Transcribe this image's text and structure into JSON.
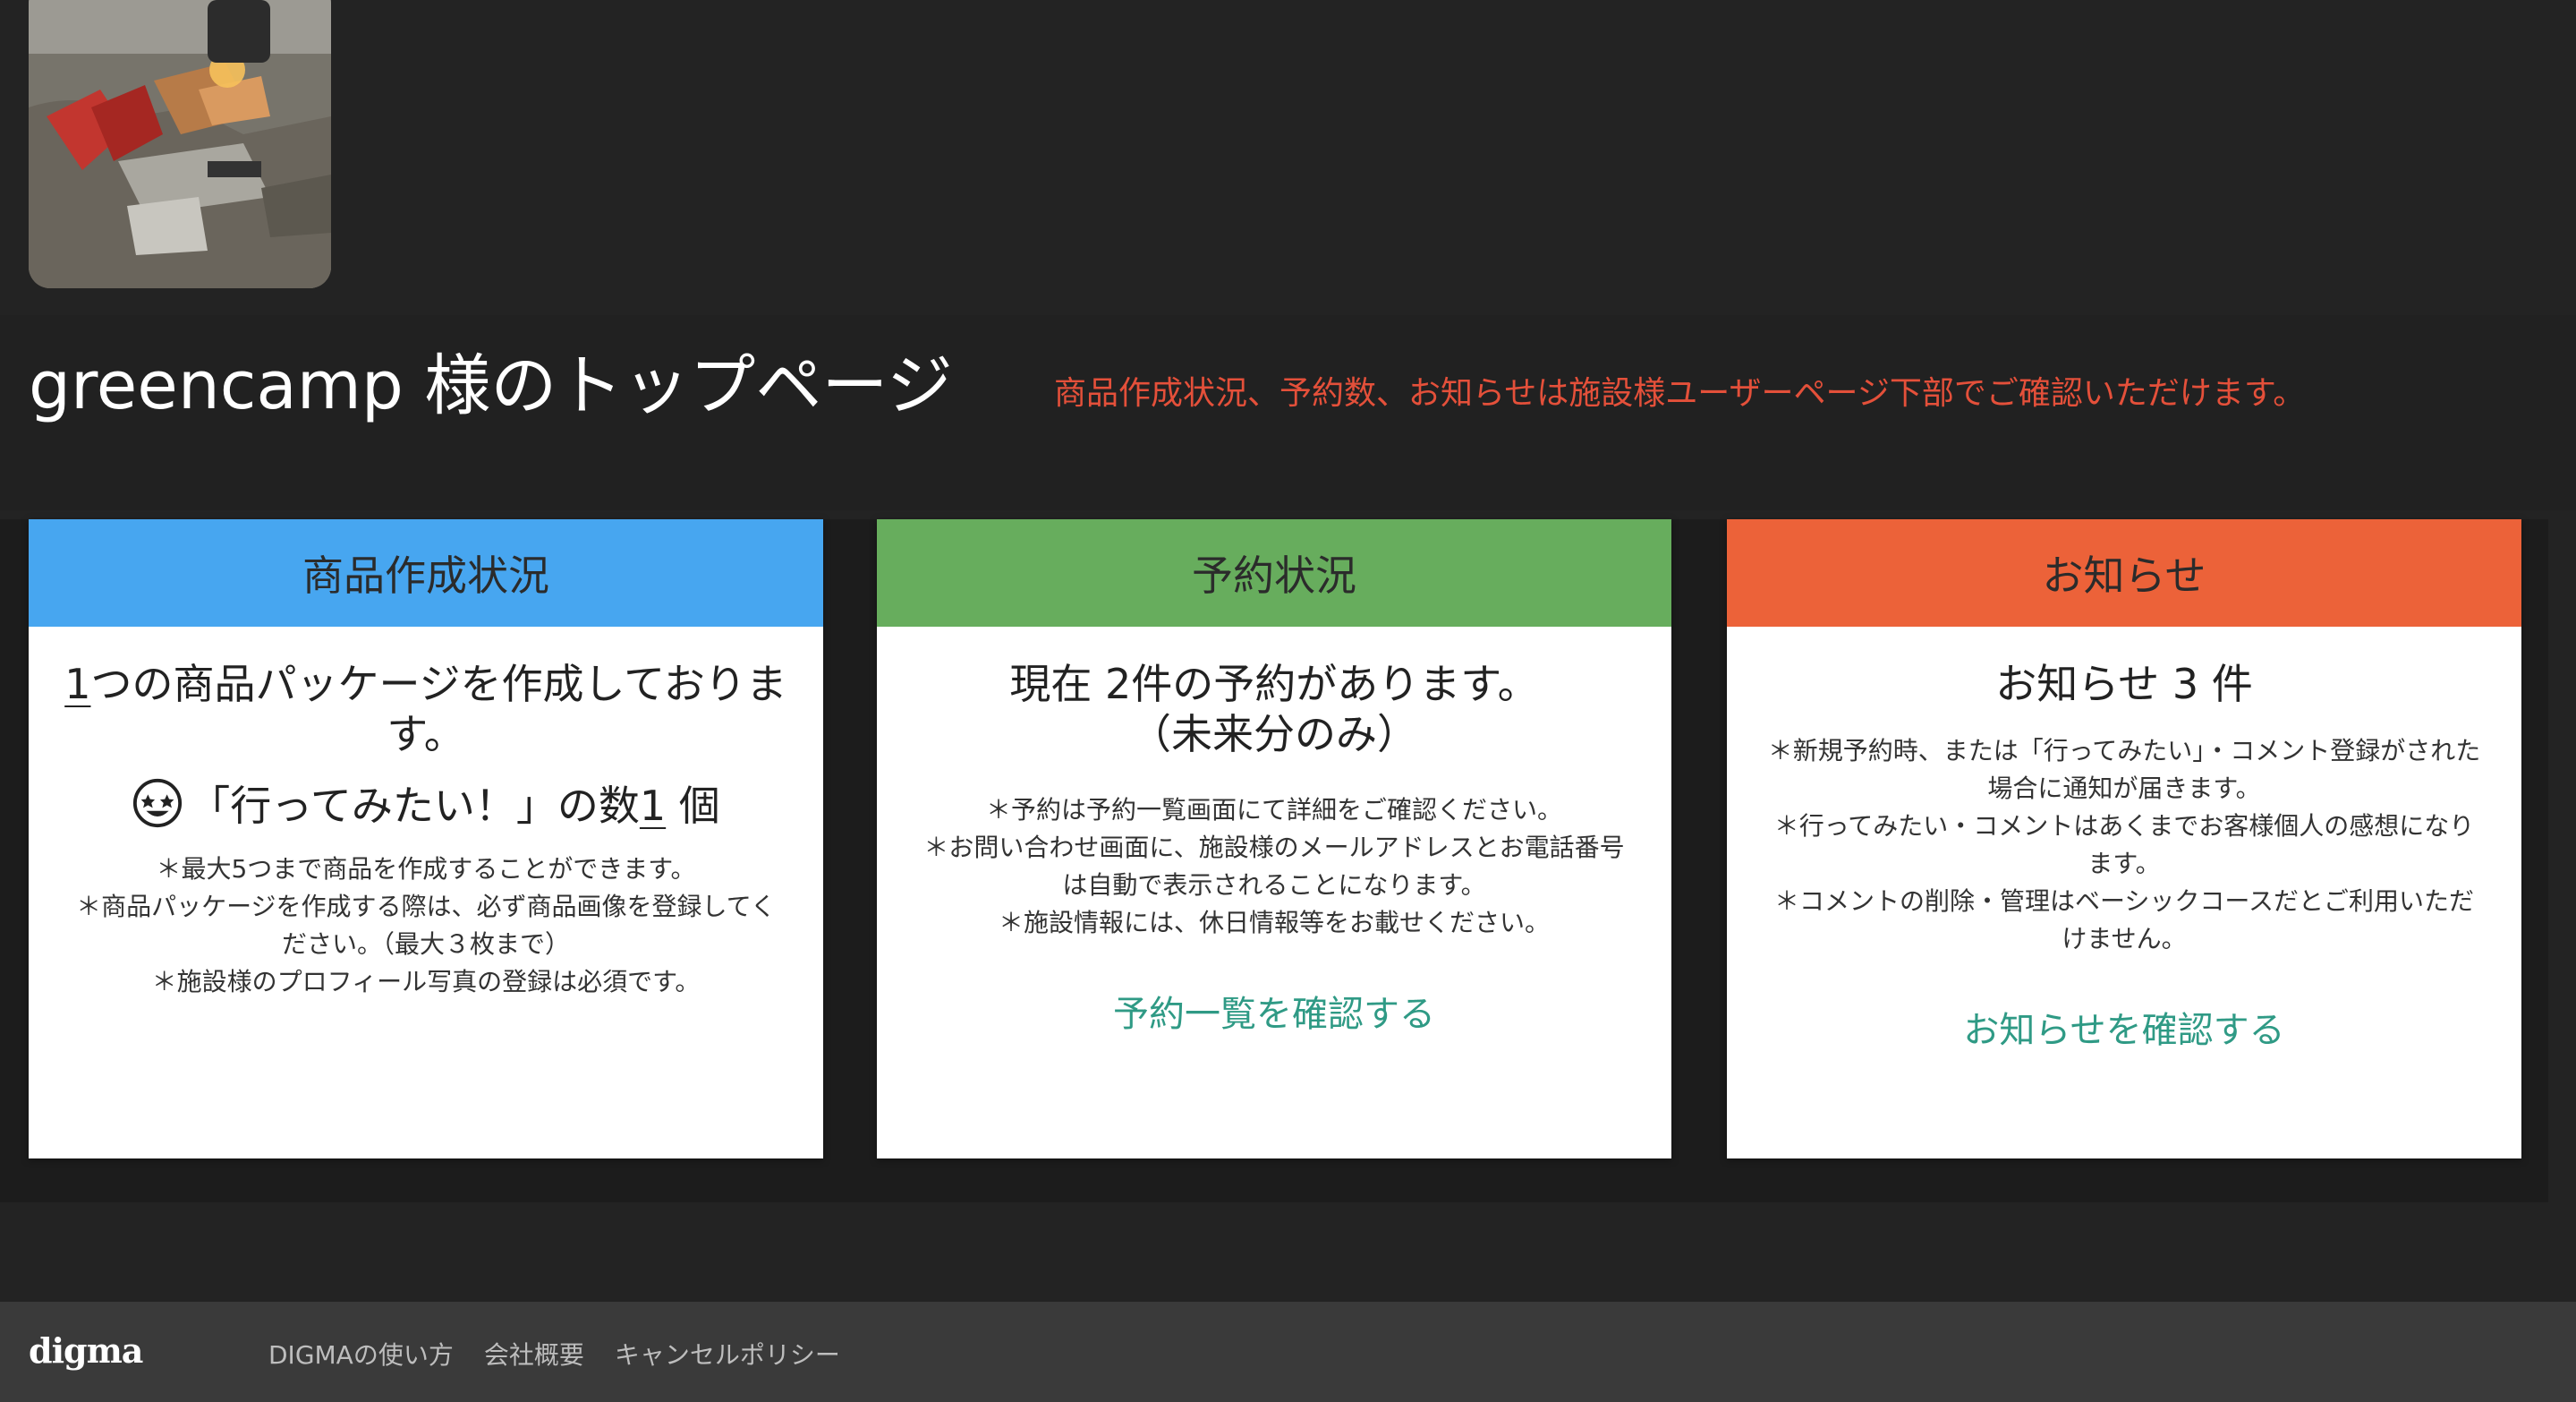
{
  "header": {
    "profile_photo_alt": "campfire photo",
    "title": "greencamp 様のトップページ",
    "notice": "商品作成状況、予約数、お知らせは施設様ユーザーページ下部でご確認いただけます。"
  },
  "cards": {
    "products": {
      "header": "商品作成状況",
      "count": "1",
      "heading_suffix": "つの商品パッケージを作成しております。",
      "like_prefix": "「行ってみたい！」の数",
      "like_count": "1",
      "like_suffix": " 個",
      "notes": [
        "＊最大5つまで商品を作成することができます。",
        "＊商品パッケージを作成する際は、必ず商品画像を登録してください。（最大３枚まで）",
        "＊施設様のプロフィール写真の登録は必須です。"
      ],
      "color": "#47a6f0"
    },
    "reservations": {
      "header": "予約状況",
      "heading_line1": "現在 2件の予約があります。",
      "heading_line2": "（未来分のみ）",
      "notes": [
        "＊予約は予約一覧画面にて詳細をご確認ください。",
        "＊お問い合わせ画面に、施設様のメールアドレスとお電話番号は自動で表示されることになります。",
        "＊施設情報には、休日情報等をお載せください。"
      ],
      "link": "予約一覧を確認する",
      "color": "#67ad5d"
    },
    "notices": {
      "header": "お知らせ",
      "heading": "お知らせ 3 件",
      "notes": [
        "＊新規予約時、または「行ってみたい」・コメント登録がされた場合に通知が届きます。",
        "＊行ってみたい・コメントはあくまでお客様個人の感想になります。",
        "＊コメントの削除・管理はベーシックコースだとご利用いただけません。"
      ],
      "link": "お知らせを確認する",
      "color": "#ec6239"
    }
  },
  "footer": {
    "logo": "digma",
    "links": [
      "DIGMAの使い方",
      "会社概要",
      "キャンセルポリシー"
    ]
  },
  "colors": {
    "background": "#232323",
    "notice_red": "#e4503a",
    "link_teal": "#2f9a85",
    "footer_bg": "#3a3a3a"
  },
  "icons": {
    "like": "star-eyes-emoji-icon"
  }
}
